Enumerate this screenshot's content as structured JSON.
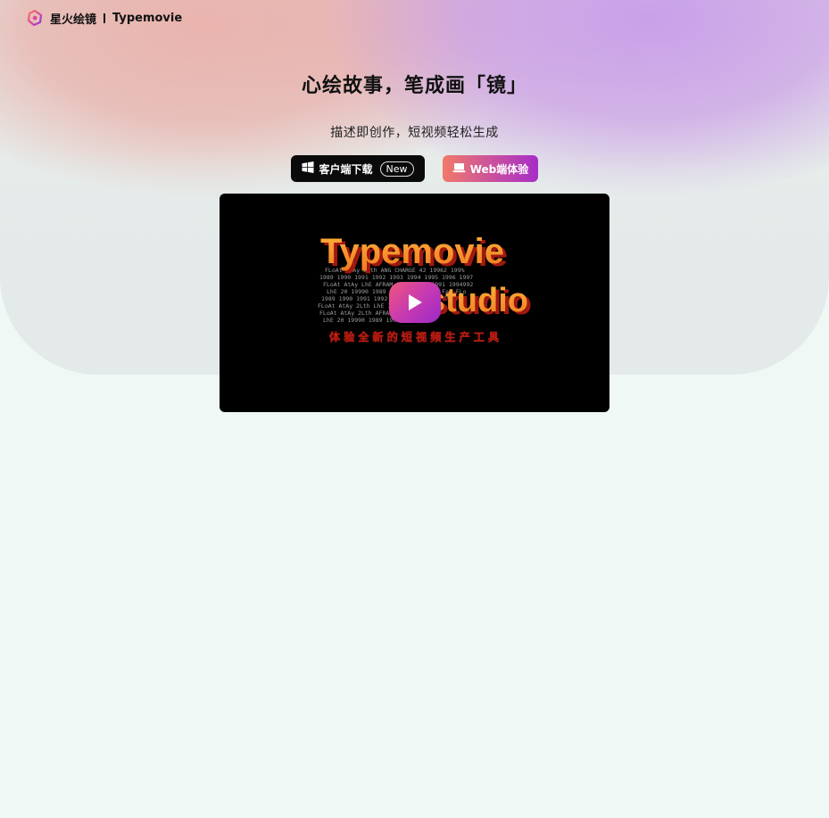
{
  "header": {
    "brand_cn": "星火绘镜",
    "brand_en": "Typemovie"
  },
  "hero": {
    "headline": "心绘故事，笔成画「镜」",
    "subline": "描述即创作，短视频轻松生成"
  },
  "actions": {
    "download_label": "客户端下载",
    "download_badge": "New",
    "web_label": "Web端体验"
  },
  "video": {
    "title_line1": "Typemovie",
    "title_line2": "studio",
    "tagline": "体 验 全 新 的 短 视 频 生 产 工 具"
  },
  "colors": {
    "accent_gradient_start": "#f07a6a",
    "accent_gradient_end": "#a62ec8",
    "video_text_orange": "#ff9a2e",
    "download_button": "#0a0a0a"
  }
}
